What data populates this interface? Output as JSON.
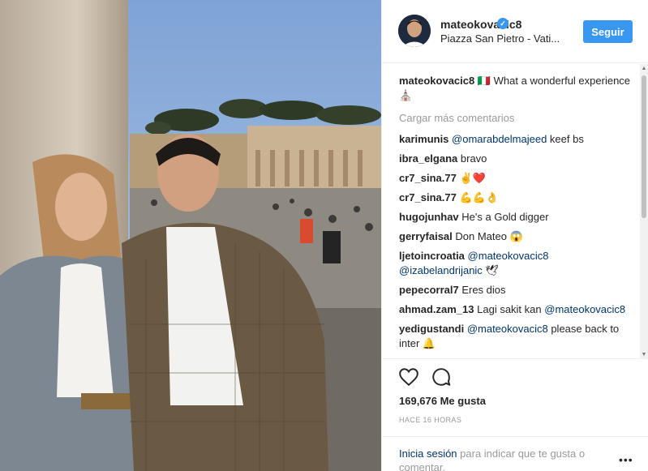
{
  "post": {
    "username": "mateokovacic8",
    "location": "Piazza San Pietro - Vati...",
    "follow_label": "Seguir",
    "caption_text": "🇮🇹 What a wonderful experience ⛪"
  },
  "comments_section": {
    "load_more": "Cargar más comentarios",
    "items": [
      {
        "user": "karimunis",
        "mention": "@omarabdelmajeed",
        "text": " keef bs"
      },
      {
        "user": "ibra_elgana",
        "mention": "",
        "text": "bravo"
      },
      {
        "user": "cr7_sina.77",
        "mention": "",
        "text": "✌️❤️"
      },
      {
        "user": "cr7_sina.77",
        "mention": "",
        "text": "💪💪👌"
      },
      {
        "user": "hugojunhav",
        "mention": "",
        "text": "He's a Gold digger"
      },
      {
        "user": "gerryfaisal",
        "mention": "",
        "text": "Don Mateo 😱"
      },
      {
        "user": "ljetoincroatia",
        "mention": "@mateokovacic8 @izabelandrijanic",
        "text": " 🕊"
      },
      {
        "user": "pepecorral7",
        "mention": "",
        "text": "Eres dios"
      },
      {
        "user": "ahmad.zam_13",
        "mention": "",
        "text": "Lagi sakit kan",
        "mention_after": "@mateokovacic8"
      },
      {
        "user": "yedigustandi",
        "mention": "@mateokovacic8",
        "text": " please back to inter 🔔"
      }
    ]
  },
  "engagement": {
    "likes": "169,676 Me gusta",
    "time": "HACE 16 HORAS"
  },
  "footer": {
    "login_link": "Inicia sesión",
    "login_rest": " para indicar que te gusta o comentar."
  },
  "icons": {
    "verified": "verified-badge-icon",
    "like": "heart-outline-icon",
    "comment": "speech-bubble-icon",
    "more": "more-options-icon"
  },
  "colors": {
    "accent": "#3897f0",
    "link": "#003569",
    "muted": "#999999",
    "text": "#262626"
  }
}
